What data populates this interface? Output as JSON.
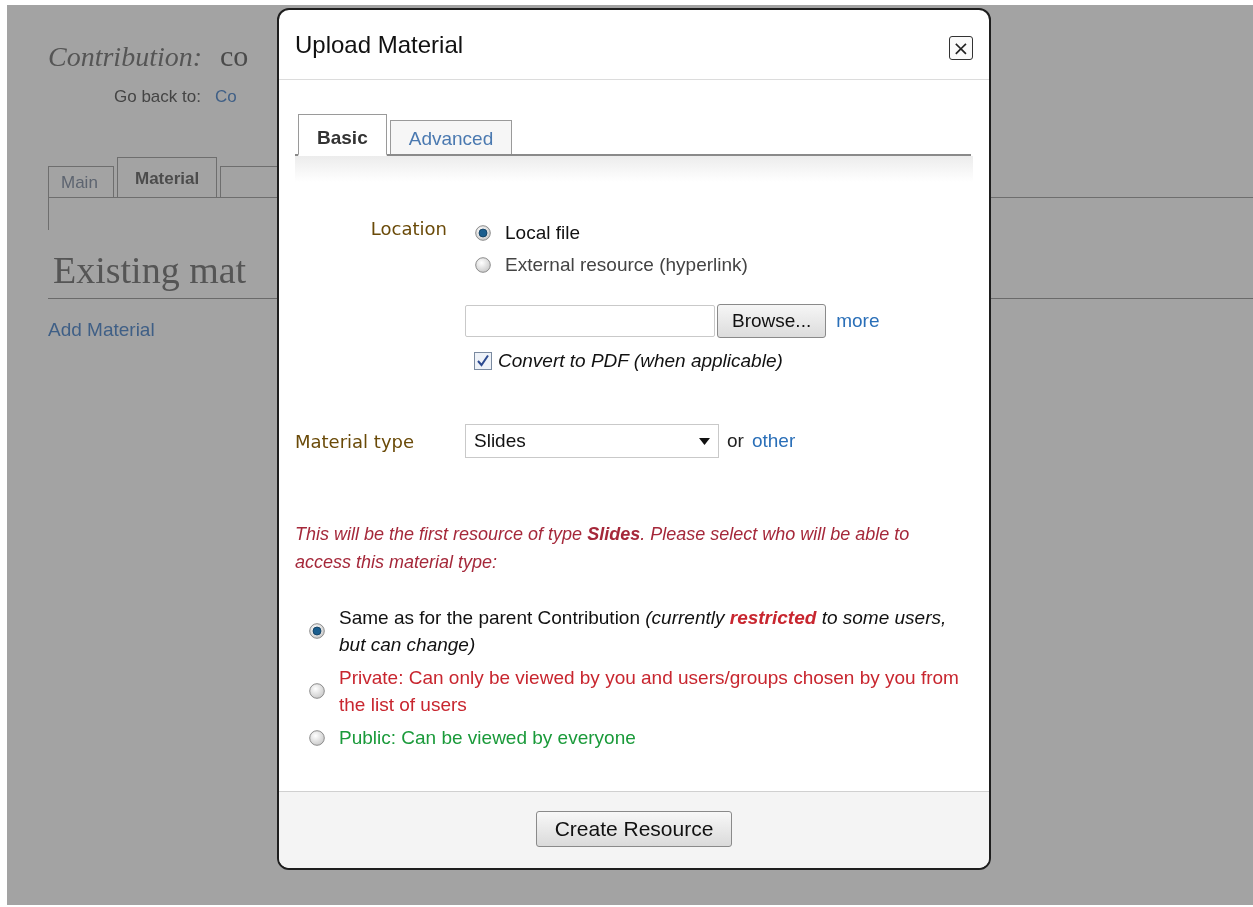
{
  "page": {
    "title_label": "Contribution:",
    "title_value": "co",
    "go_back_label": "Go back to:",
    "go_back_link": "Co",
    "tabs": [
      {
        "label": "Main",
        "selected": false
      },
      {
        "label": "Material",
        "selected": true
      },
      {
        "selected": false
      }
    ],
    "section_heading": "Existing mat",
    "add_link": "Add Material"
  },
  "dialog": {
    "title": "Upload Material",
    "close": "×",
    "tabs": [
      {
        "label": "Basic",
        "selected": true
      },
      {
        "label": "Advanced",
        "selected": false
      }
    ],
    "location_label": "Location",
    "location_options": [
      {
        "label": "Local file",
        "selected": true
      },
      {
        "label": "External resource (hyperlink)",
        "selected": false
      }
    ],
    "file_button": "Browse...",
    "more_link": "more",
    "convert": {
      "label": "Convert to PDF (when applicable)",
      "checked": true
    },
    "material_type_label": "Material type",
    "material_type": "Slides",
    "or_text": "or",
    "other_link": "other",
    "message": "This will be the first resource of type **Slides**. Please select who will be able to access this material type:",
    "access_options": [
      {
        "kind": "default",
        "text": "Same as for the parent Contribution",
        "note": "(currently **restricted** to some users, but can change)",
        "selected": true
      },
      {
        "kind": "private",
        "text": "Private: Can only be viewed by you and users/groups chosen by you from the list of users",
        "selected": false
      },
      {
        "kind": "public",
        "text": "Public: Can be viewed by everyone",
        "selected": false
      }
    ],
    "submit": "Create Resource"
  }
}
